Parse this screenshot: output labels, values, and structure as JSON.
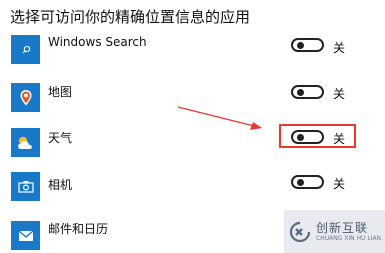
{
  "heading": "选择可访问你的精确位置信息的应用",
  "apps": [
    {
      "name": "Windows Search",
      "icon": "search-icon",
      "toggle_state": "关",
      "on": false
    },
    {
      "name": "地图",
      "icon": "map-pin-icon",
      "toggle_state": "关",
      "on": false
    },
    {
      "name": "天气",
      "icon": "weather-icon",
      "toggle_state": "关",
      "on": false,
      "highlighted": true
    },
    {
      "name": "相机",
      "icon": "camera-icon",
      "toggle_state": "关",
      "on": false
    },
    {
      "name": "邮件和日历",
      "icon": "mail-icon",
      "toggle_state": "",
      "on": false
    }
  ],
  "watermark": {
    "cn": "创新互联",
    "en": "CHUANG XIN HU LIAN"
  },
  "colors": {
    "tile": "#1979c9",
    "highlight": "#e33a32",
    "arrow": "#e33a32"
  }
}
